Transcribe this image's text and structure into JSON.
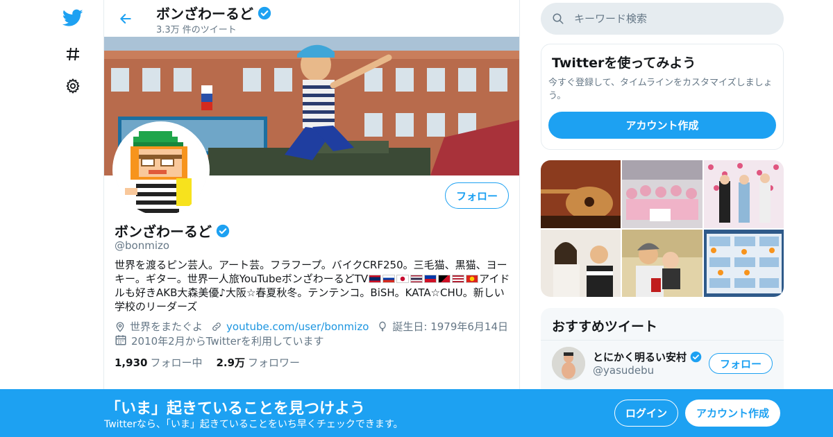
{
  "nav": {
    "icons": [
      "twitter-logo-icon",
      "hashtag-icon",
      "settings-gear-icon"
    ]
  },
  "header": {
    "name": "ボンざわーるど",
    "tweet_count": "3.3万 件のツイート"
  },
  "profile": {
    "name": "ボンざわーるど",
    "handle": "@bonmizo",
    "follow_label": "フォロー",
    "bio_part1": "世界を渡るピン芸人。アート芸。フラフープ。バイクCRF250。三毛猫、黒猫、ヨーキー。ギター。世界一人旅YouTubeボンざわーるどTV",
    "bio_part2": "アイドルも好きAKB大森美優♪大阪☆春夏秋冬。テンテンコ。BiSH。KATA☆CHU。新しい学校のリーダーズ",
    "location": "世界をまたぐよ",
    "website": "youtube.com/user/bonmizo",
    "birthday": "誕生日: 1979年6月14日",
    "joined": "2010年2月からTwitterを利用しています",
    "following_count": "1,930",
    "following_label": "フォロー中",
    "followers_count": "2.9万",
    "followers_label": "フォロワー"
  },
  "search": {
    "placeholder": "キーワード検索"
  },
  "signup_box": {
    "title": "Twitterを使ってみよう",
    "description": "今すぐ登録して、タイムラインをカスタマイズしましょう。",
    "button": "アカウント作成"
  },
  "recommended": {
    "title": "おすすめツイート",
    "user_name": "とにかく明るい安村",
    "user_handle": "@yasudebu",
    "follow_label": "フォロー"
  },
  "bottom_bar": {
    "title": "「いま」起きていることを見つけよう",
    "subtitle": "Twitterなら、「いま」起きていることをいち早くチェックできます。",
    "login_label": "ログイン",
    "create_label": "アカウント作成"
  },
  "colors": {
    "accent": "#1da1f2",
    "text": "#14171a",
    "muted": "#657786",
    "border": "#e6ecf0"
  }
}
